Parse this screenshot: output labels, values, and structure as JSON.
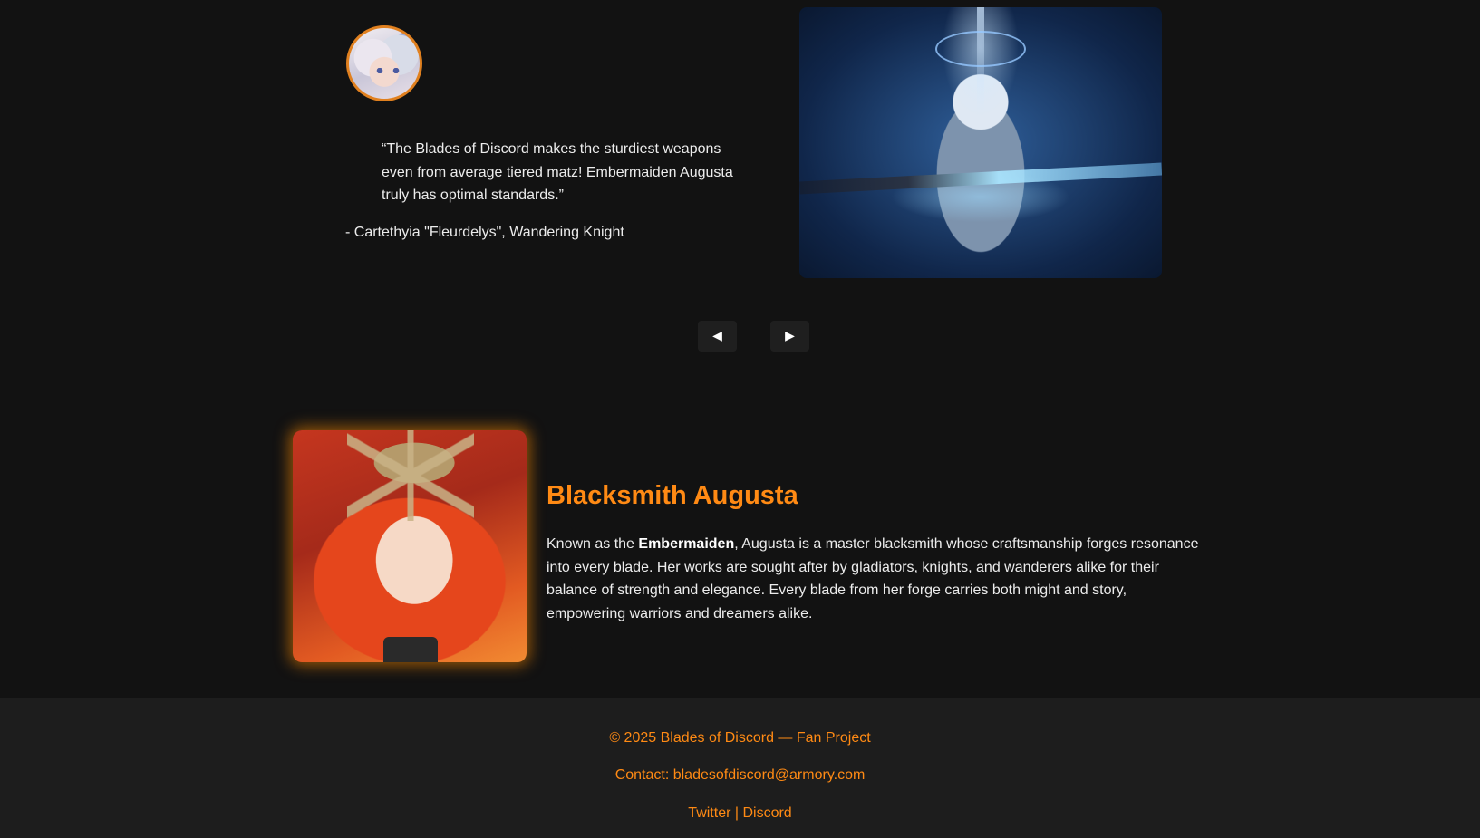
{
  "testimonial": {
    "quote": "“The Blades of Discord makes the sturdiest weapons even from average tiered matz! Embermaiden Augusta truly has optimal standards.”",
    "attribution": "- Cartethyia \"Fleurdelys\", Wandering Knight"
  },
  "carousel": {
    "prev_label": "◀",
    "next_label": "▶"
  },
  "about": {
    "title": "Blacksmith Augusta",
    "text_before": "Known as the ",
    "text_bold": "Embermaiden",
    "text_after": ", Augusta is a master blacksmith whose craftsmanship forges resonance into every blade. Her works are sought after by gladiators, knights, and wanderers alike for their balance of strength and elegance. Every blade from her forge carries both might and story, empowering warriors and dreamers alike."
  },
  "footer": {
    "copyright": "© 2025 Blades of Discord — Fan Project",
    "contact": "Contact: bladesofdiscord@armory.com",
    "twitter": "Twitter",
    "separator": " | ",
    "discord": "Discord"
  },
  "colors": {
    "background": "#121212",
    "accent": "#ff8a14",
    "footer_background": "#1d1d1d",
    "button_background": "#1f1f1f"
  }
}
